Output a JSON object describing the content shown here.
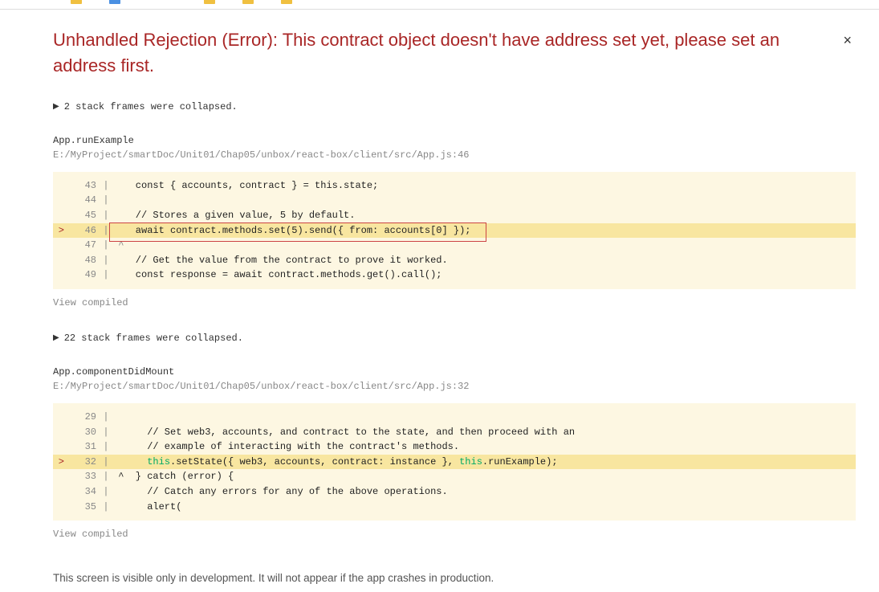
{
  "error": {
    "title": "Unhandled Rejection (Error): This contract object doesn't have address set yet, please set an address first.",
    "close": "×"
  },
  "collapsed1": "2 stack frames were collapsed.",
  "frame1": {
    "name": "App.runExample",
    "path": "E:/MyProject/smartDoc/Unit01/Chap05/unbox/react-box/client/src/App.js:46",
    "lines": {
      "n43": "43",
      "n44": "44",
      "n45": "45",
      "n46": "46",
      "n47": "47",
      "n48": "48",
      "n49": "49",
      "c43": "    const { accounts, contract } = this.state;",
      "c44": "",
      "c45": "    // Stores a given value, 5 by default.",
      "c46": "    await contract.methods.set(5).send({ from: accounts[0] });",
      "c47": "^",
      "c48": "    // Get the value from the contract to prove it worked.",
      "c49": "    const response = await contract.methods.get().call();"
    },
    "view": "View compiled"
  },
  "collapsed2": "22 stack frames were collapsed.",
  "frame2": {
    "name": "App.componentDidMount",
    "path": "E:/MyProject/smartDoc/Unit01/Chap05/unbox/react-box/client/src/App.js:32",
    "lines": {
      "n29": "29",
      "n30": "30",
      "n31": "31",
      "n32": "32",
      "n33": "33",
      "n34": "34",
      "n35": "35",
      "c29": "",
      "c30": "      // Set web3, accounts, and contract to the state, and then proceed with an",
      "c31": "      // example of interacting with the contract's methods.",
      "c32_a": "      ",
      "c32_this": "this",
      "c32_b": ".setState({ web3, accounts, contract: instance }, ",
      "c32_c": "this",
      "c32_d": ".runExample);",
      "c33": " ^  } catch (error) {",
      "c34": "      // Catch any errors for any of the above operations.",
      "c35": "      alert("
    },
    "view": "View compiled"
  },
  "footer": "This screen is visible only in development. It will not appear if the app crashes in production."
}
